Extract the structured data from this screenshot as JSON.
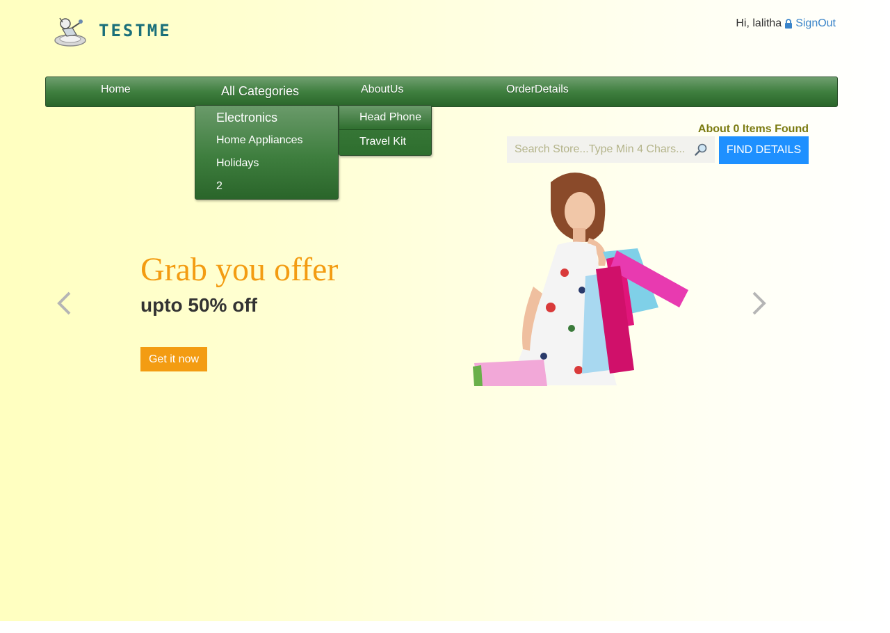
{
  "header": {
    "logo_text": "TESTME",
    "greeting": "Hi, lalitha",
    "signout_label": "SignOut"
  },
  "nav": {
    "items": [
      "Home",
      "All Categories",
      "AboutUs",
      "OrderDetails"
    ],
    "active": "All Categories"
  },
  "categories_dropdown": {
    "items": [
      "Electronics",
      "Home Appliances",
      "Holidays",
      "2"
    ],
    "active": "Electronics"
  },
  "electronics_submenu": {
    "items": [
      "Head Phone",
      "Travel Kit"
    ]
  },
  "search": {
    "items_found_text": "About 0 Items Found",
    "placeholder": "Search Store...Type Min 4 Chars...",
    "value": "",
    "button_label": "FIND DETAILS"
  },
  "carousel": {
    "title": "Grab you offer",
    "subtitle": "upto 50% off",
    "button_label": "Get it now"
  },
  "colors": {
    "nav_green": "#3f7f3f",
    "offer_orange": "#f39c12",
    "find_button_blue": "#1e90ff",
    "items_found_olive": "#7a7a10",
    "link_blue": "#3a84c9"
  }
}
